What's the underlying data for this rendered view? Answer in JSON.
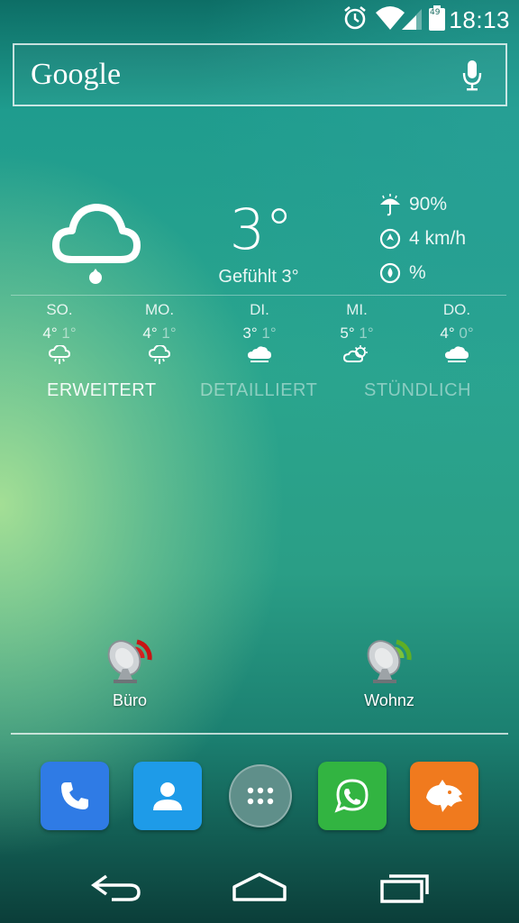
{
  "status_bar": {
    "time": "18:13",
    "icons": [
      "alarm-icon",
      "wifi-icon",
      "signal-icon",
      "battery-icon"
    ],
    "battery_level": "49"
  },
  "search": {
    "logo": "Google",
    "icon": "mic-icon"
  },
  "weather": {
    "current_icon": "rain-cloud-icon",
    "temperature": "3°",
    "feels_like": "Gefühlt 3°",
    "precipitation": "90%",
    "wind": "4 km/h",
    "humidity": "%",
    "forecast": [
      {
        "day": "SO.",
        "high": "4°",
        "low": "1°",
        "icon": "rain-icon"
      },
      {
        "day": "MO.",
        "high": "4°",
        "low": "1°",
        "icon": "rain-icon"
      },
      {
        "day": "DI.",
        "high": "3°",
        "low": "1°",
        "icon": "cloud-icon"
      },
      {
        "day": "MI.",
        "high": "5°",
        "low": "1°",
        "icon": "partly-sunny-icon"
      },
      {
        "day": "DO.",
        "high": "4°",
        "low": "0°",
        "icon": "cloud-icon"
      }
    ],
    "tabs": [
      {
        "label": "ERWEITERT",
        "active": true
      },
      {
        "label": "DETAILLIERT",
        "active": false
      },
      {
        "label": "STÜNDLICH",
        "active": false
      }
    ]
  },
  "shortcuts": [
    {
      "label": "Büro",
      "icon": "satellite-dish-red-icon"
    },
    {
      "label": "Wohnz",
      "icon": "satellite-dish-green-icon"
    }
  ],
  "dock": [
    {
      "name": "phone",
      "color": "#2f7be5"
    },
    {
      "name": "contacts",
      "color": "#1e9be8"
    },
    {
      "name": "app-drawer",
      "color": "#5f8f8a"
    },
    {
      "name": "whatsapp",
      "color": "#32b441"
    },
    {
      "name": "app",
      "color": "#f07a1e"
    }
  ],
  "colors": {
    "wallpaper_top": "#0d6e66",
    "wallpaper_mid": "#2aa58e",
    "wallpaper_bottom": "#0b3e39"
  }
}
